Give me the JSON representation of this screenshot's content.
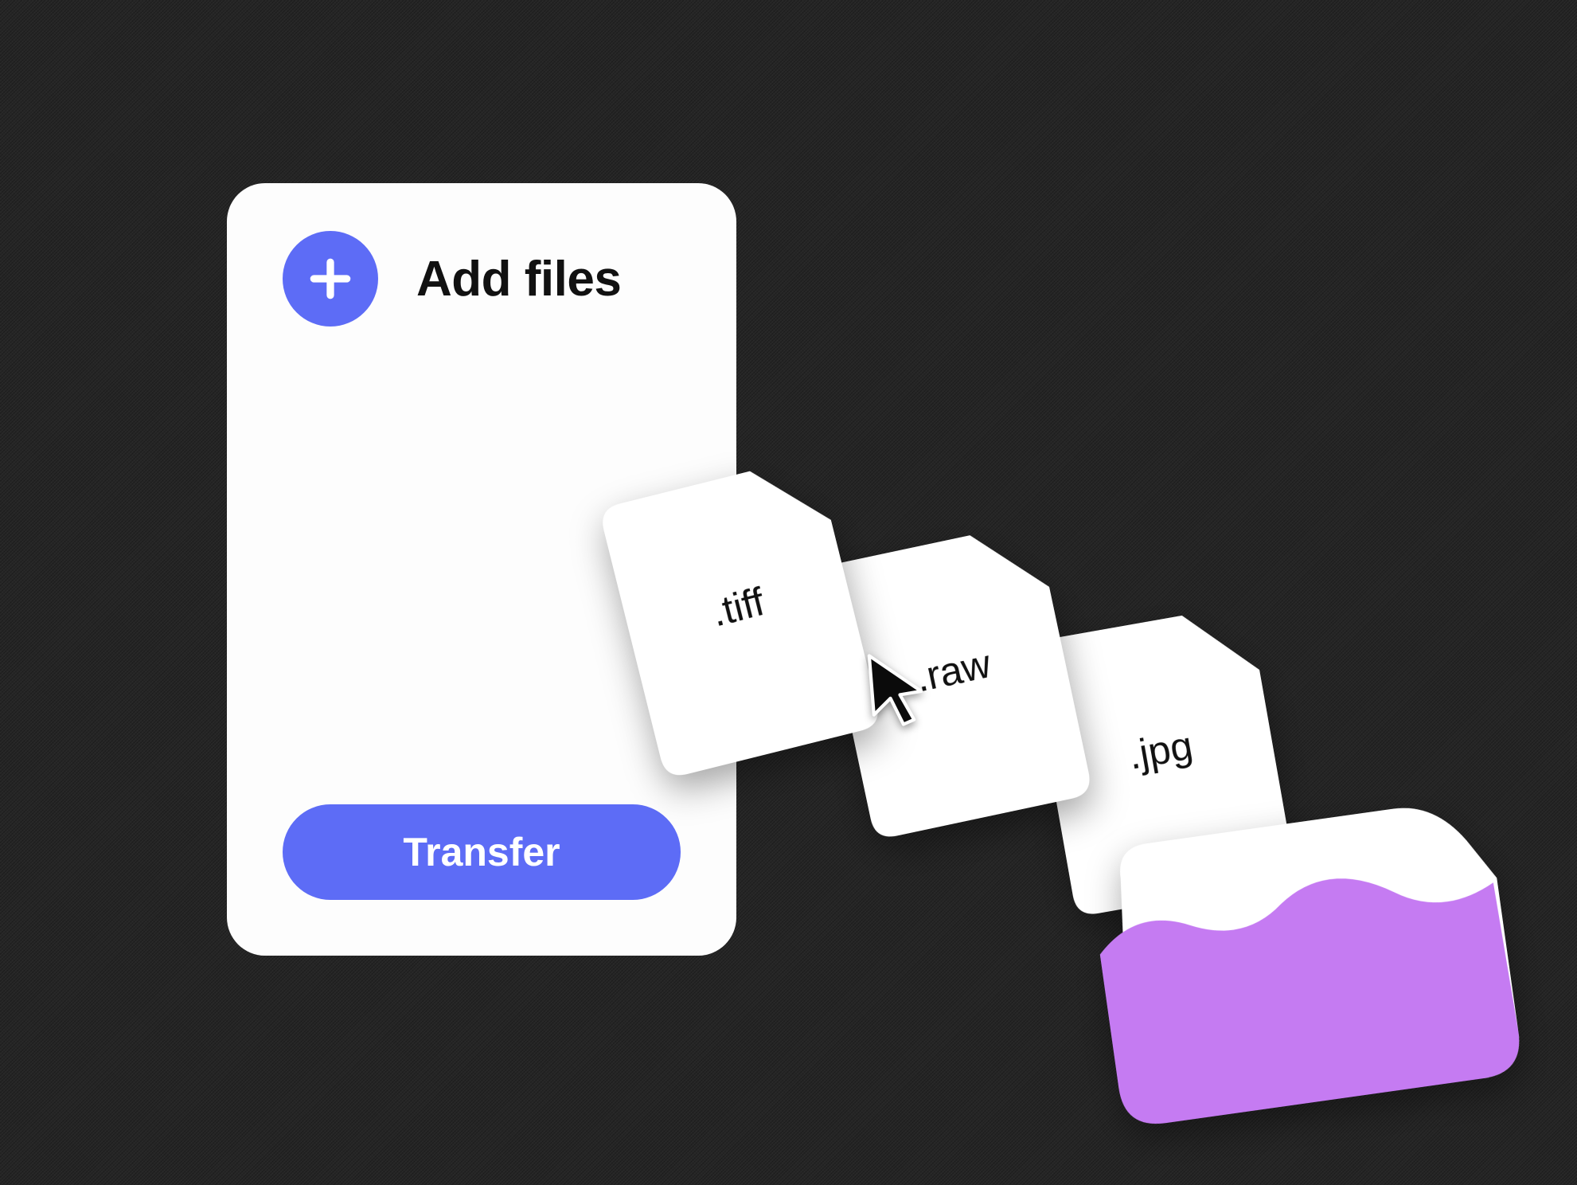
{
  "card": {
    "add_label": "Add files",
    "transfer_label": "Transfer"
  },
  "files": {
    "tiff": ".tiff",
    "raw": ".raw",
    "jpg": ".jpg"
  },
  "colors": {
    "accent": "#5d6cf6",
    "folder": "#c57bf2",
    "folder_inner": "#ffffff",
    "file_bg": "#ffffff"
  }
}
